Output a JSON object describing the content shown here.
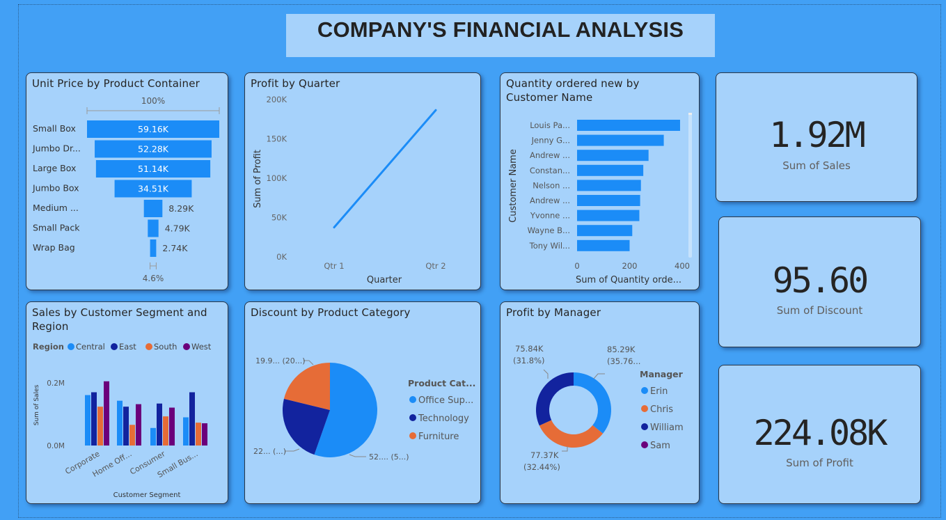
{
  "header": {
    "title": "COMPANY'S FINANCIAL ANALYSIS"
  },
  "colors": {
    "background": "#42a0f5",
    "panel": "#a6d2fb",
    "blue": "#1b8cf7",
    "navy": "#12239e",
    "orange": "#e66c37",
    "purple": "#6b007b"
  },
  "kpis": [
    {
      "value": "1.92M",
      "label": "Sum of Sales"
    },
    {
      "value": "95.60",
      "label": "Sum of Discount"
    },
    {
      "value": "224.08K",
      "label": "Sum of Profit"
    }
  ],
  "chart_data": [
    {
      "type": "bar",
      "subtype": "funnel",
      "title": "Unit Price by Product Container",
      "categories": [
        "Small Box",
        "Jumbo Dr...",
        "Large Box",
        "Jumbo Box",
        "Medium ...",
        "Small Pack",
        "Wrap Bag"
      ],
      "values": [
        59160,
        52280,
        51140,
        34510,
        8290,
        4790,
        2740
      ],
      "data_labels": [
        "59.16K",
        "52.28K",
        "51.14K",
        "34.51K",
        "8.29K",
        "4.79K",
        "2.74K"
      ],
      "top_pct_label": "100%",
      "bottom_pct_label": "4.6%"
    },
    {
      "type": "line",
      "title": "Profit by Quarter",
      "x": [
        "Qtr 1",
        "Qtr 2"
      ],
      "values": [
        37500,
        186500
      ],
      "xlabel": "Quarter",
      "ylabel": "Sum of Profit",
      "ylim": [
        0,
        200000
      ],
      "yticks": [
        "0K",
        "50K",
        "100K",
        "150K",
        "200K"
      ]
    },
    {
      "type": "bar",
      "orientation": "horizontal",
      "title": "Quantity ordered new by Customer Name",
      "categories": [
        "Louis Pa...",
        "Jenny G...",
        "Andrew ...",
        "Constan...",
        "Nelson ...",
        "Andrew ...",
        "Yvonne ...",
        "Wayne B...",
        "Tony Wil..."
      ],
      "values": [
        392,
        330,
        272,
        252,
        243,
        240,
        237,
        210,
        200
      ],
      "xlabel": "Sum of Quantity orde...",
      "ylabel": "Customer Name",
      "xlim": [
        0,
        420
      ],
      "xticks": [
        "0",
        "200",
        "400"
      ]
    },
    {
      "type": "bar",
      "subtype": "clustered",
      "title": "Sales by Customer Segment and Region",
      "legend_title": "Region",
      "categories": [
        "Corporate",
        "Home Off...",
        "Consumer",
        "Small Bus..."
      ],
      "series": [
        {
          "name": "Central",
          "values": [
            0.161,
            0.143,
            0.056,
            0.09
          ]
        },
        {
          "name": "East",
          "values": [
            0.17,
            0.124,
            0.134,
            0.17
          ]
        },
        {
          "name": "South",
          "values": [
            0.124,
            0.066,
            0.093,
            0.073
          ]
        },
        {
          "name": "West",
          "values": [
            0.205,
            0.132,
            0.121,
            0.071
          ]
        }
      ],
      "xlabel": "Customer Segment",
      "ylabel": "Sum of Sales",
      "ylim": [
        0,
        0.22
      ],
      "yticks": [
        "0.0M",
        "0.2M"
      ]
    },
    {
      "type": "pie",
      "title": "Discount by Product Category",
      "legend_title": "Product Cat...",
      "labels": [
        "Office Sup...",
        "Technology",
        "Furniture"
      ],
      "values": [
        52,
        22,
        19.9
      ],
      "data_labels": [
        "52.... (5...)",
        "22... (...)",
        "19.9... (20...)"
      ]
    },
    {
      "type": "pie",
      "subtype": "donut",
      "title": "Profit by Manager",
      "legend_title": "Manager",
      "labels": [
        "Erin",
        "Chris",
        "William",
        "Sam"
      ],
      "values": [
        85.29,
        77.37,
        75.84,
        0
      ],
      "data_labels": [
        {
          "value": "85.29K",
          "pct": "(35.76..."
        },
        {
          "value": "77.37K",
          "pct": "(32.44%)"
        },
        {
          "value": "75.84K",
          "pct": "(31.8%)"
        }
      ]
    }
  ]
}
